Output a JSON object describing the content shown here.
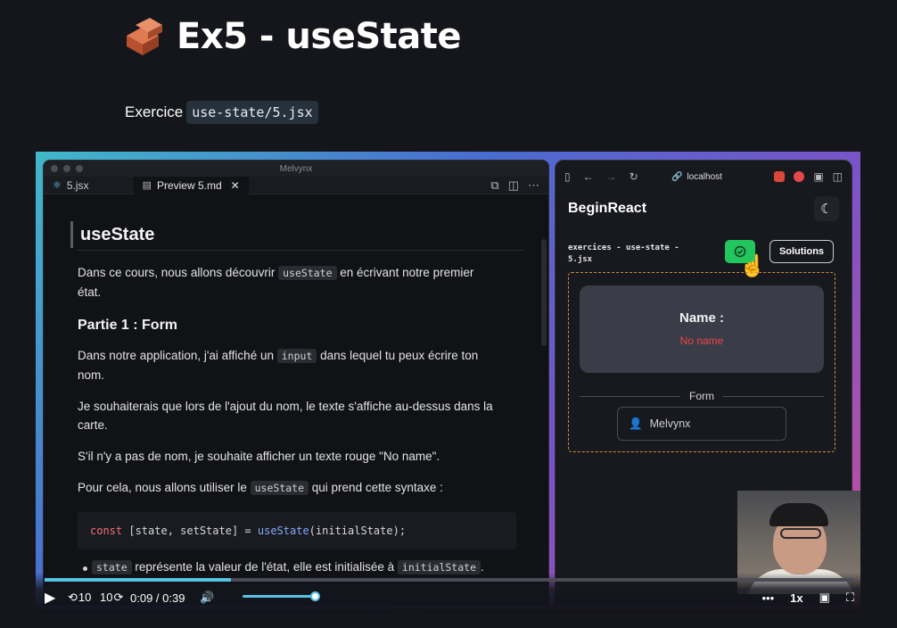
{
  "page": {
    "emoji_name": "brick-icon",
    "title": "Ex5 - useState",
    "subtitle_prefix": "Exercice",
    "subtitle_code": "use-state/5.jsx"
  },
  "editor": {
    "window_title": "Melvynx",
    "tabs": [
      {
        "label": "5.jsx",
        "icon": "react-icon"
      },
      {
        "label": "Preview 5.md",
        "icon": "preview-icon"
      }
    ],
    "heading": "useState",
    "p1_before": "Dans ce cours, nous allons découvrir",
    "p1_code": "useState",
    "p1_after": "en écrivant notre premier état.",
    "h2": "Partie 1 : Form",
    "p2_before": "Dans notre application, j'ai affiché un",
    "p2_code": "input",
    "p2_after": "dans lequel tu peux écrire ton nom.",
    "p3": "Je souhaiterais que lors de l'ajout du nom, le texte s'affiche au-dessus dans la carte.",
    "p4": "S'il n'y a pas de nom, je souhaite afficher un texte rouge \"No name\".",
    "p5_before": "Pour cela, nous allons utiliser le",
    "p5_code": "useState",
    "p5_after": "qui prend cette syntaxe :",
    "code_kw": "const",
    "code_mid": "[state, setState] =",
    "code_fn": "useState",
    "code_arg": "(initialState);",
    "bullet_code1": "state",
    "bullet_text": "représente la valeur de l'état, elle est initialisée à",
    "bullet_code2": "initialState",
    "bullet_end": "."
  },
  "browser": {
    "url": "localhost",
    "brand": "BeginReact",
    "exercise_name": "exercices - use-state - 5.jsx",
    "solutions_label": "Solutions",
    "card_label": "Name :",
    "card_value": "No name",
    "divider_label": "Form",
    "input_value": "Melvynx",
    "accent_green": "#22c55e",
    "error_red": "#ef4444"
  },
  "player": {
    "rewind_label": "10",
    "forward_label": "10",
    "time": "0:09 / 0:39",
    "speed": "1x",
    "more": "•••",
    "progress_percent": 23,
    "volume_percent": 100,
    "accent": "#56c3e3"
  }
}
